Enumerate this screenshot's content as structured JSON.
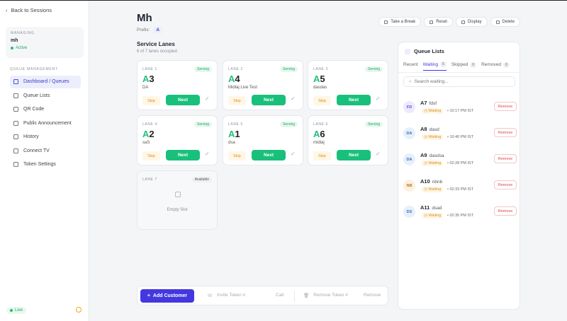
{
  "sidebar": {
    "back_label": "Back to Sessions",
    "managing_label": "MANAGING",
    "managing_name": "mh",
    "status": "Active",
    "section_label": "QUEUE MANAGEMENT",
    "items": [
      {
        "label": "Dashboard / Queues"
      },
      {
        "label": "Queue Lists"
      },
      {
        "label": "QR Code"
      },
      {
        "label": "Public Announcement"
      },
      {
        "label": "History"
      },
      {
        "label": "Connect TV"
      },
      {
        "label": "Token Settings"
      }
    ],
    "live_label": "Live"
  },
  "header": {
    "title": "Mh",
    "prefix_label": "Prefix:",
    "prefix_value": "A",
    "buttons": {
      "break": "Take a Break",
      "reset": "Reset",
      "display": "Display",
      "delete": "Delete"
    }
  },
  "lanes": {
    "title": "Service Lanes",
    "subtitle": "6 of 7 lanes occupied",
    "skip_label": "Skip",
    "next_label": "Next",
    "serving_label": "Serving",
    "available_label": "Available",
    "empty_label": "Empty Slot",
    "cards": [
      {
        "lane": "LANE 1",
        "prefix": "A",
        "num": "3",
        "name": "DA"
      },
      {
        "lane": "LANE 2",
        "prefix": "A",
        "num": "4",
        "name": "Midlaj Live Test"
      },
      {
        "lane": "LANE 3",
        "prefix": "A",
        "num": "5",
        "name": "dasdas"
      },
      {
        "lane": "LANE 4",
        "prefix": "A",
        "num": "2",
        "name": "saS"
      },
      {
        "lane": "LANE 5",
        "prefix": "A",
        "num": "1",
        "name": "dsa"
      },
      {
        "lane": "LANE 6",
        "prefix": "A",
        "num": "6",
        "name": "midlaj"
      }
    ],
    "empty_lane": "LANE 7"
  },
  "bottom": {
    "add_label": "Add Customer",
    "invite_placeholder": "Invite Token #",
    "call_label": "Call",
    "remove_placeholder": "Remove Token #",
    "remove_label": "Remove"
  },
  "queue": {
    "title": "Queue Lists",
    "tabs": [
      {
        "label": "Recent",
        "count": ""
      },
      {
        "label": "Waiting",
        "count": "5"
      },
      {
        "label": "Skipped",
        "count": "0"
      },
      {
        "label": "Removed",
        "count": "0"
      }
    ],
    "search_placeholder": "Search waiting...",
    "waiting_label": "Waiting",
    "remove_label": "Remove",
    "items": [
      {
        "initials": "FD",
        "token": "A7",
        "name": "fdsf",
        "time": "• 10:17 PM IST"
      },
      {
        "initials": "DA",
        "token": "A8",
        "name": "dasd",
        "time": "• 10:40 PM IST"
      },
      {
        "initials": "DA",
        "token": "A9",
        "name": "dasdsa",
        "time": "• 02:28 PM IST"
      },
      {
        "initials": "NB",
        "token": "A10",
        "name": "nbnb",
        "time": "• 02:33 PM IST"
      },
      {
        "initials": "DS",
        "token": "A11",
        "name": "dsad",
        "time": "• 02:35 PM IST"
      }
    ]
  },
  "colors": {
    "accent": "#4338e0",
    "green": "#19c07b",
    "warn": "#d9921a",
    "danger": "#e04444"
  }
}
